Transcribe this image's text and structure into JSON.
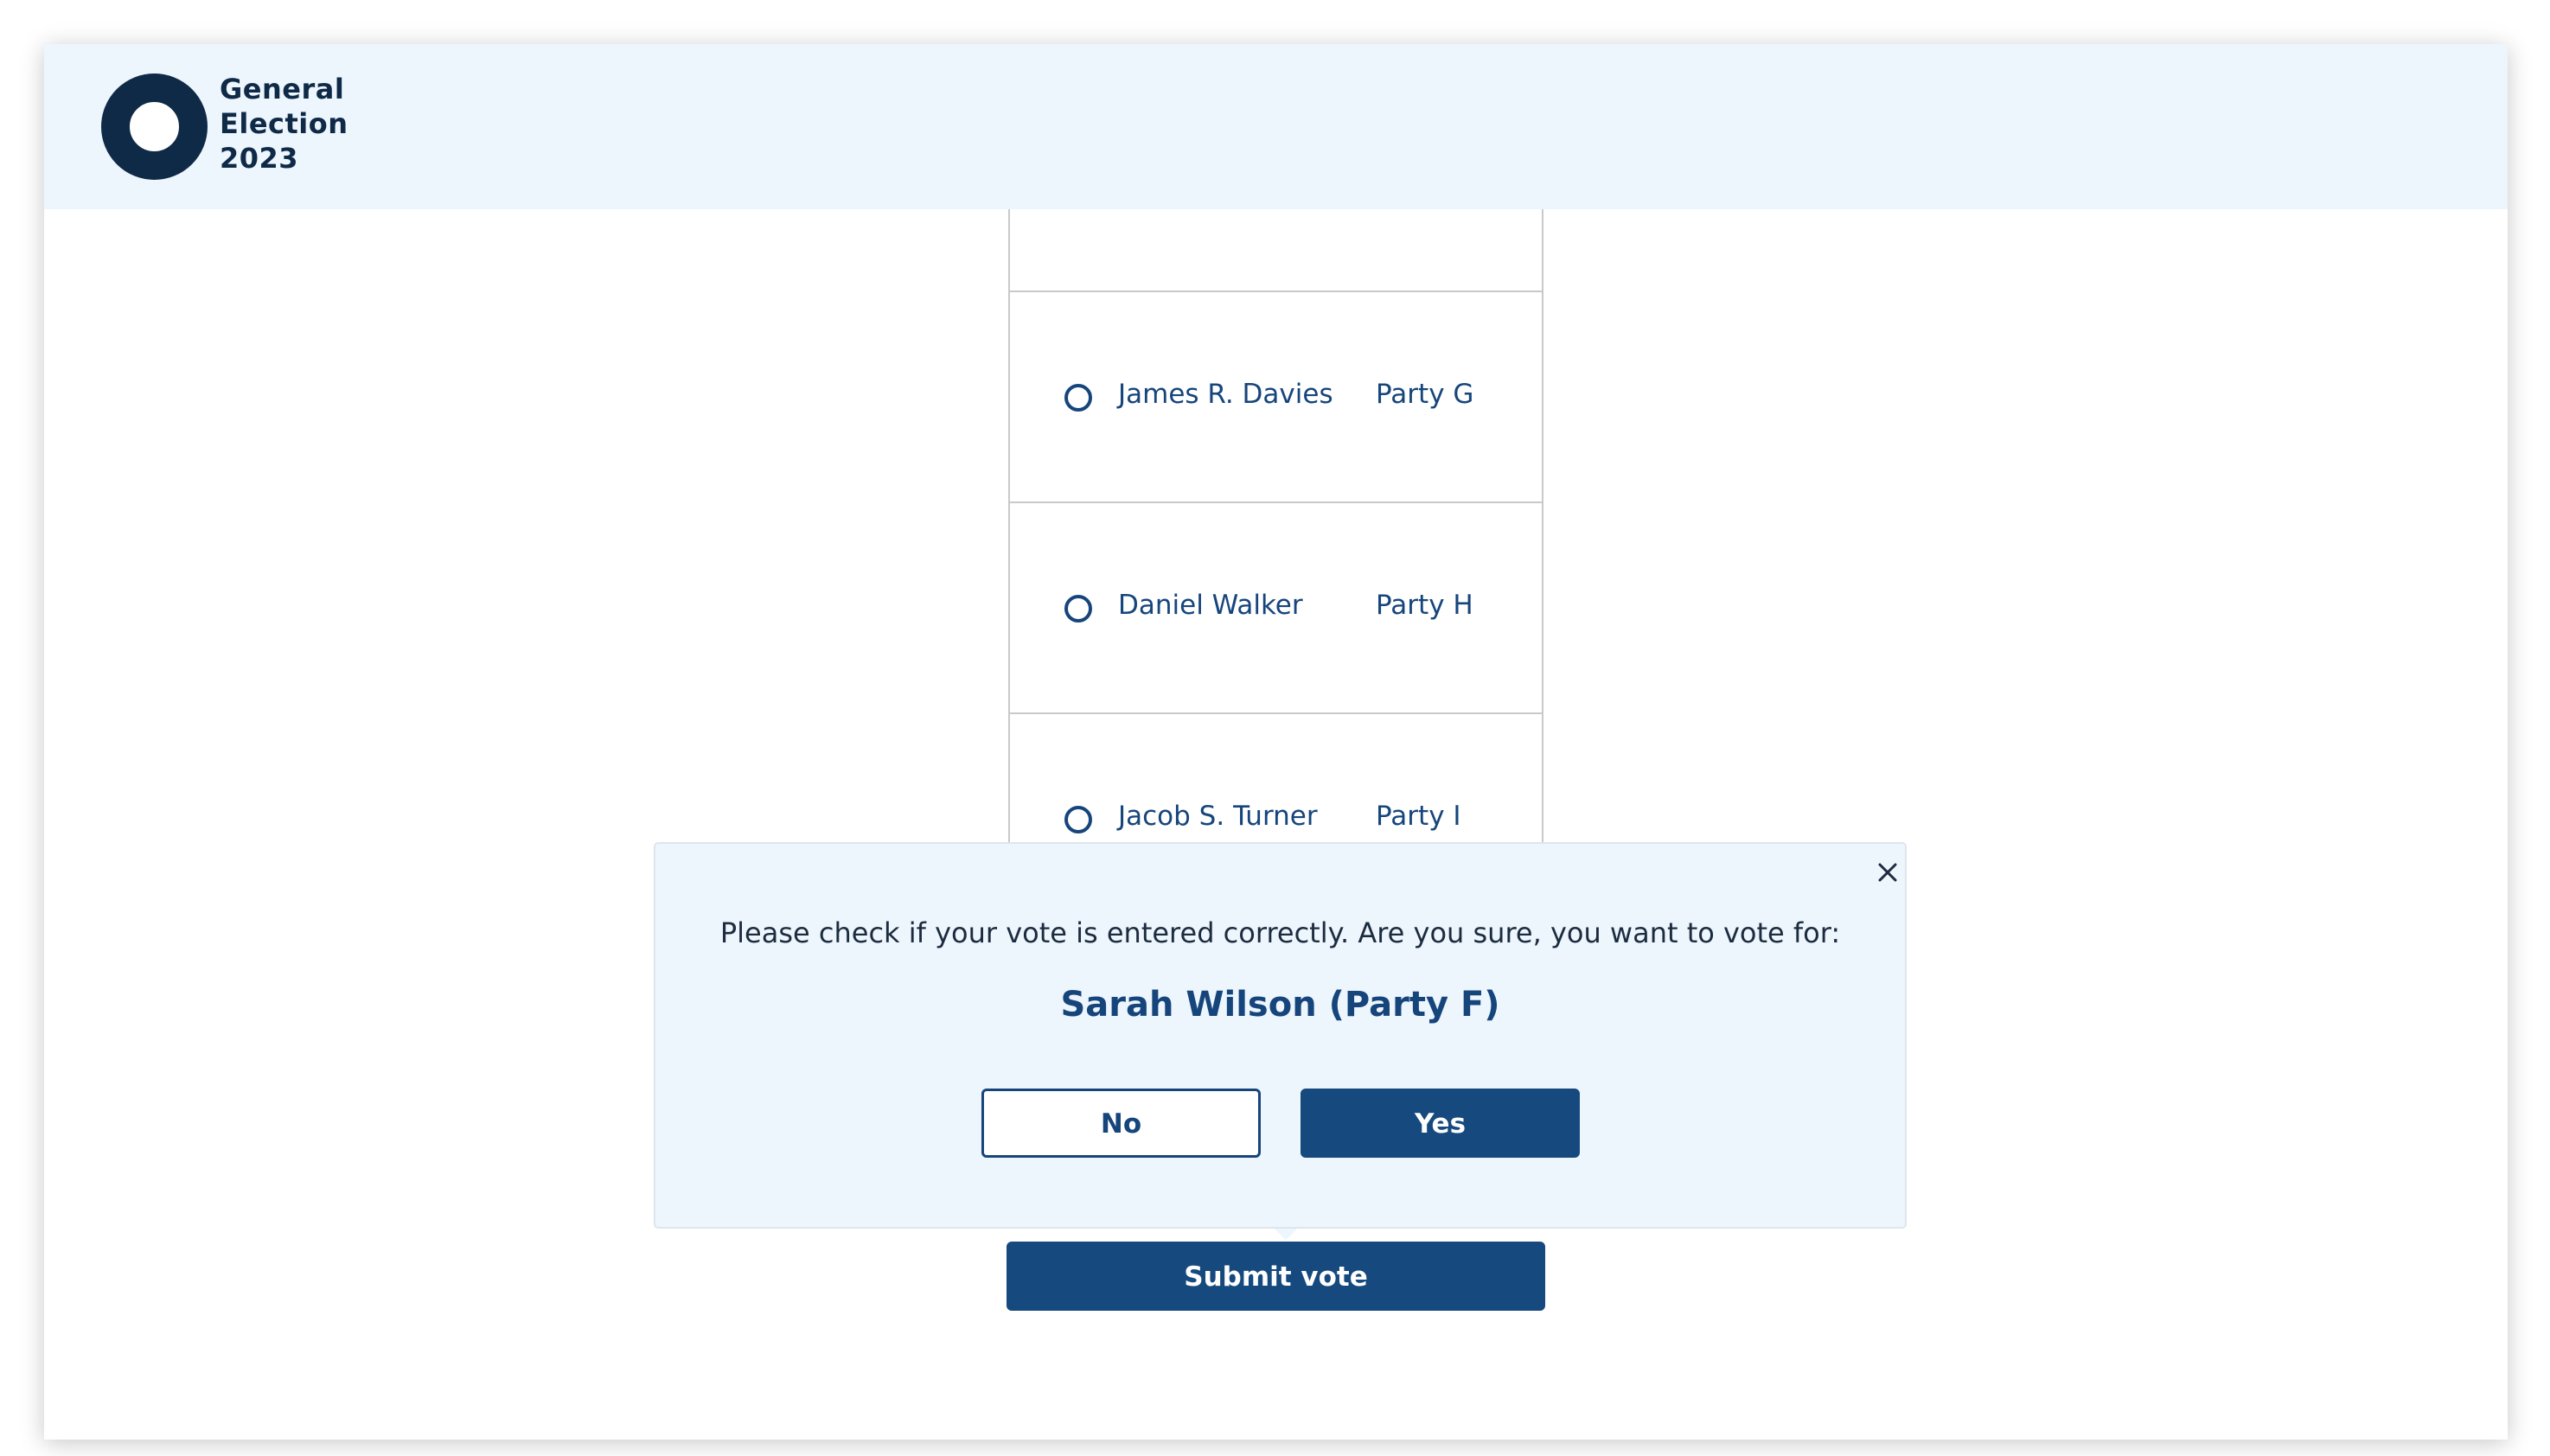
{
  "header": {
    "logo_line1": "General",
    "logo_line2": "Election",
    "logo_line3": "2023"
  },
  "candidates": [
    {
      "name": "James R. Davies",
      "party": "Party G"
    },
    {
      "name": "Daniel Walker",
      "party": "Party H"
    },
    {
      "name": "Jacob S. Turner",
      "party": "Party I"
    }
  ],
  "dialog": {
    "message": "Please check if your vote is entered correctly. Are you sure, you want to vote for:",
    "selected_choice": "Sarah Wilson (Party F)",
    "no_label": "No",
    "yes_label": "Yes"
  },
  "submit_label": "Submit vote",
  "colors": {
    "primary": "#16497e",
    "header_bg": "#edf5fd",
    "logo": "#0f2a47"
  }
}
